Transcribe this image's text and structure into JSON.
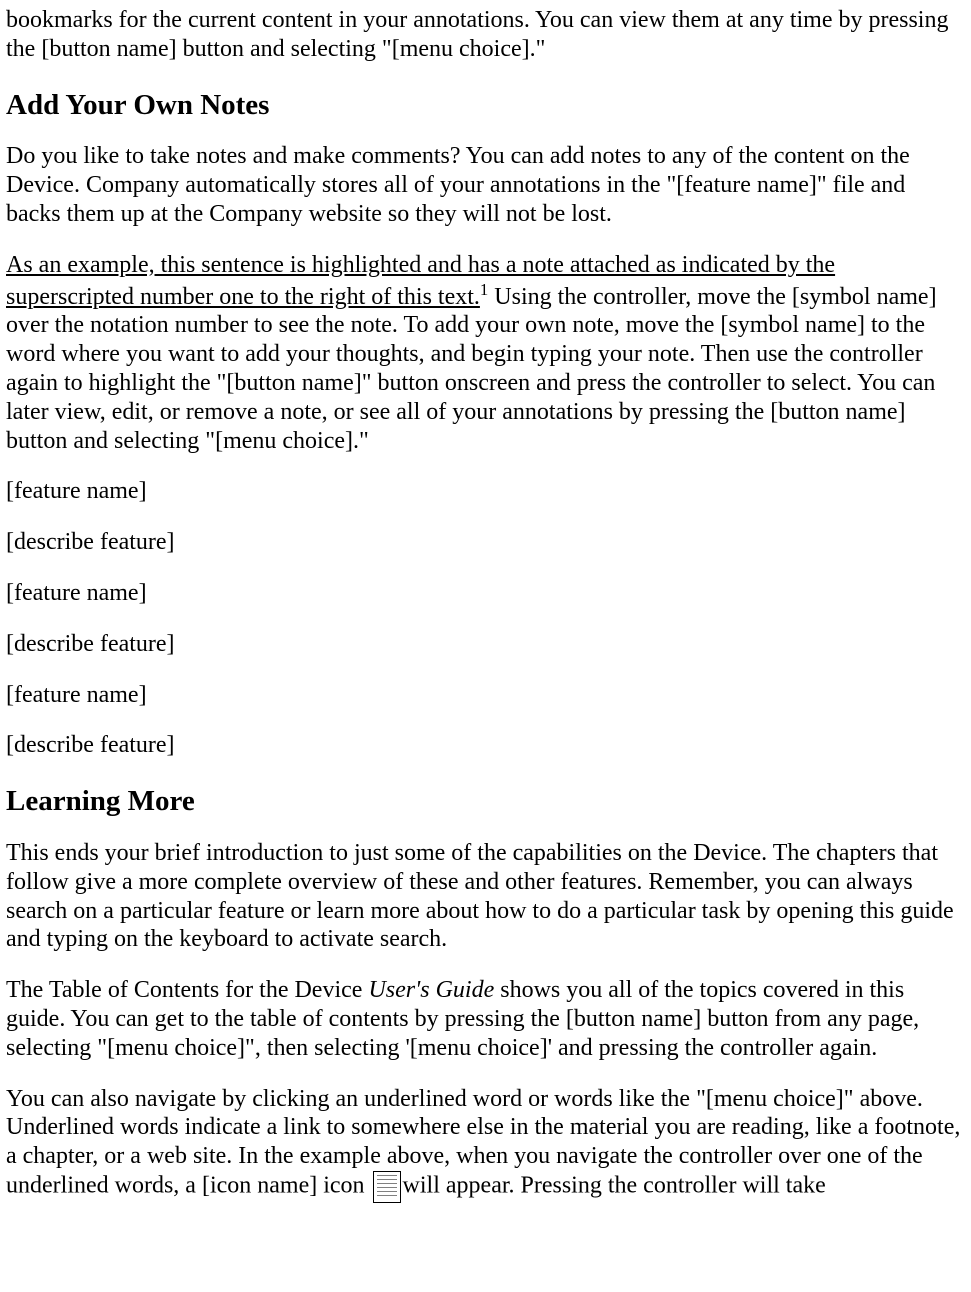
{
  "intro_p1": "bookmarks for the current content in your annotations. You can view them at any time by pressing the [button name] button and selecting \"[menu choice].\"",
  "section_add_notes": {
    "heading": "Add Your Own Notes",
    "p1": "Do you like to take notes and make comments? You can add notes to any of the content on the Device. Company automatically stores all of your annotations in the \"[feature name]\" file and backs them up at the Company website so they will not be lost.",
    "p2_underlined": "As an example, this sentence is highlighted and has a note attached as indicated by the superscripted number one to the right of this text.",
    "p2_sup": "1",
    "p2_rest": " Using the controller, move the [symbol name] over the notation number to see the note. To add your own note, move the [symbol name] to the word where you want to add your thoughts, and begin typing your note. Then use the controller again to highlight the \"[button name]\" button onscreen and press the controller to select. You can later view, edit, or remove a note, or see all of your annotations by pressing the [button name] button and selecting \"[menu choice].\"",
    "placeholders": [
      "[feature name]",
      "[describe feature]",
      "[feature name]",
      "[describe feature]",
      "[feature name]",
      "[describe feature]"
    ]
  },
  "section_learning": {
    "heading": "Learning More",
    "p1": "This ends your brief introduction to just some of the capabilities on the Device. The chapters that follow give a more complete overview of these and other features. Remember, you can always search on a particular feature or learn more about how to do a particular task by opening this guide and typing on the keyboard to activate search.",
    "p2_a": "The Table of Contents for the Device ",
    "p2_italic": "User's Guide",
    "p2_b": " shows you all of the topics covered in this guide. You can get to the table of contents by pressing the [button name] button from any page, selecting \"[menu choice]\", then selecting '[menu choice]' and pressing the controller again.",
    "p3_a": "You can also navigate by clicking an underlined word or words like the \"[menu choice]\" above. Underlined words indicate a link to somewhere else in the material you are reading, like a footnote, a chapter, or a web site. In the example above, when you navigate the controller over one of the underlined words, a [icon name] icon ",
    "p3_b": "will appear. Pressing the controller will take"
  }
}
